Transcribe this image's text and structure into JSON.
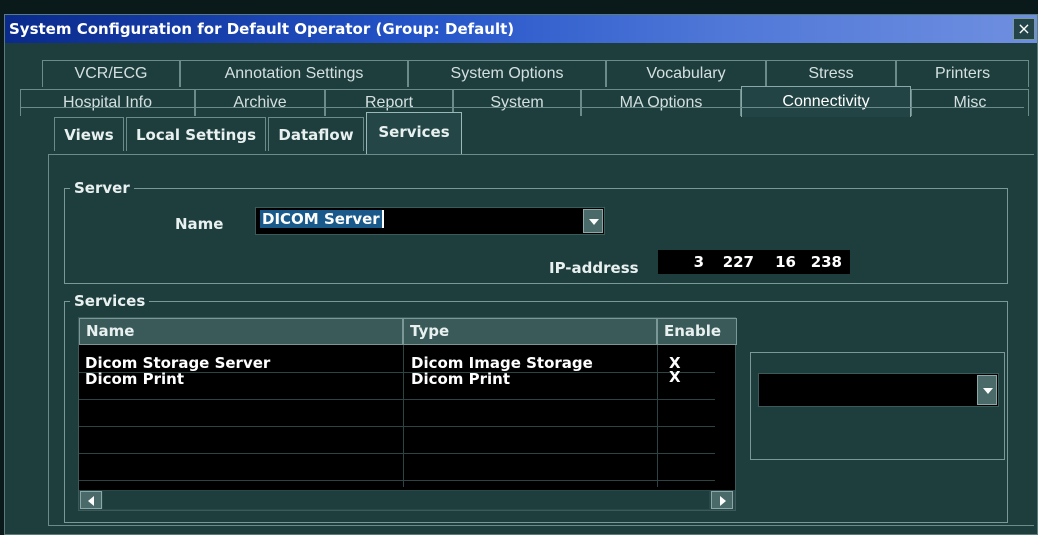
{
  "window": {
    "title": "System Configuration for Default Operator (Group: Default)",
    "close_label": "×"
  },
  "tabs_row1": [
    "VCR/ECG",
    "Annotation Settings",
    "System Options",
    "Vocabulary",
    "Stress",
    "Printers"
  ],
  "tabs_row2": [
    "Hospital Info",
    "Archive",
    "Report",
    "System",
    "MA Options",
    "Connectivity",
    "Misc"
  ],
  "active_tab": "Connectivity",
  "subtabs": [
    "Views",
    "Local Settings",
    "Dataflow",
    "Services"
  ],
  "active_subtab": "Services",
  "server": {
    "group_label": "Server",
    "name_label": "Name",
    "name_value": "DICOM Server",
    "ip_label": "IP-address",
    "ip": [
      "3",
      "227",
      "16",
      "238"
    ]
  },
  "services": {
    "group_label": "Services",
    "columns": [
      "Name",
      "Type",
      "Enable"
    ],
    "rows": [
      {
        "name": "Dicom Storage Server",
        "type": "Dicom Image Storage",
        "enable": "X"
      },
      {
        "name": "Dicom Print",
        "type": "Dicom Print",
        "enable": "X"
      }
    ],
    "side_combo_value": ""
  },
  "colors": {
    "panel": "#1e3d3d",
    "title_start": "#0a2a8c",
    "title_end": "#6f8fe0",
    "field": "#000000"
  }
}
